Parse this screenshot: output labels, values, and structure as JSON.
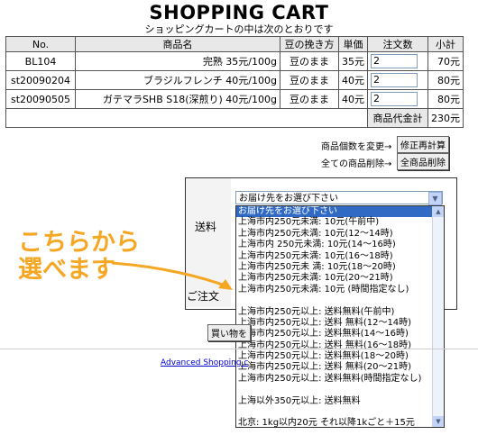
{
  "header": {
    "title": "SHOPPING CART",
    "subtitle": "ショッピングカートの中は次のとおりです"
  },
  "cart": {
    "columns": [
      "No.",
      "商品名",
      "豆の挽き方",
      "単価",
      "注文数",
      "小計"
    ],
    "rows": [
      {
        "no": "BL104",
        "name": "完熟 35元/100g",
        "grind": "豆のまま",
        "price": "35元",
        "qty": "2",
        "subtotal": "70元"
      },
      {
        "no": "st20090204",
        "name": "ブラジルフレンチ 40元/100g",
        "grind": "豆のまま",
        "price": "40元",
        "qty": "2",
        "subtotal": "80元"
      },
      {
        "no": "st20090505",
        "name": "ガテマラSHB S18(深煎り) 40元/100g",
        "grind": "豆のまま",
        "price": "40元",
        "qty": "2",
        "subtotal": "80元"
      }
    ],
    "total_label": "商品代金計",
    "total_value": "230元"
  },
  "actions": {
    "change_qty_label": "商品個数を変更→",
    "recalc_button": "修正再計算",
    "delete_all_label": "全ての商品削除→",
    "delete_all_button": "全商品削除"
  },
  "shipping_form": {
    "shipping_label": "送料",
    "order_label": "ご注文",
    "select_value": "お届け先をお選び下さい",
    "options": [
      "お届け先をお選び下さい",
      "上海市内250元未満: 10元(午前中)",
      "上海市内250元未満: 10元(12〜14時)",
      "上海市内 250元未満: 10元(14〜16時)",
      "上海市内250元未満: 10元(16〜18時)",
      "上海市内250元未 満: 10元(18〜20時)",
      "上海市内250元未満: 10元(20〜21時)",
      "上海市内250元未満: 10元 (時間指定なし)",
      "",
      "上海市内250元以上: 送料無料(午前中)",
      "上海市内250元以上: 送料 無料(12〜14時)",
      "上海市内250元以上: 送料無料(14〜16時)",
      "上海市内250元以上: 送料 無料(16〜18時)",
      "上海市内250元以上: 送料無料(18〜20時)",
      "上海市内250元以上: 送料 無料(20〜21時)",
      "上海市内250元以上: 送料無料(時間指定なし)",
      "",
      "上海以外350元以上: 送料無料",
      "",
      "北京: 1kg以内20元 それ以降1kごと＋15元"
    ]
  },
  "callout": {
    "line1": "こちらから",
    "line2": "選べます"
  },
  "footer": {
    "buy_button": "買い物を",
    "link_text": "Advanced Shopping c"
  },
  "colors": {
    "selected_bg": "#316ac5",
    "callout": "#f5a623",
    "link": "#0000cc"
  }
}
